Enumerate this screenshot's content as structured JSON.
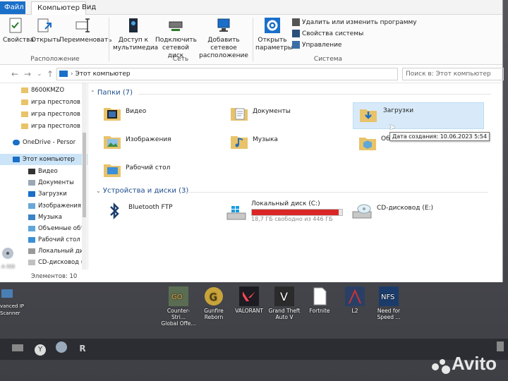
{
  "tabs": {
    "file": "Файл",
    "computer": "Компьютер",
    "view": "Вид"
  },
  "ribbon": {
    "properties": "Свойства",
    "open": "Открыть",
    "rename": "Переименовать",
    "location_group": "Расположение",
    "media_access_1": "Доступ к",
    "media_access_2": "мультимедиа",
    "map_drive_1": "Подключить",
    "map_drive_2": "сетевой диск",
    "add_location_1": "Добавить сетевое",
    "add_location_2": "расположение",
    "network_group": "Сеть",
    "open_settings_1": "Открыть",
    "open_settings_2": "параметры",
    "uninstall": "Удалить или изменить программу",
    "system_props": "Свойства системы",
    "manage": "Управление",
    "system_group": "Система"
  },
  "address": {
    "path": "Этот компьютер",
    "search_placeholder": "Поиск в: Этот компьютер"
  },
  "sidebar": {
    "items": [
      "8600KMZO",
      "игра престолов",
      "игра престолов",
      "игра престолов",
      "OneDrive - Persor",
      "Этот компьютер",
      "Видео",
      "Документы",
      "Загрузки",
      "Изображения",
      "Музыка",
      "Объемные объ",
      "Рабочий стол",
      "Локальный дис",
      "CD-дисковод (E"
    ]
  },
  "status": {
    "items_count": "Элементов: 10"
  },
  "folders_section": {
    "title": "Папки",
    "count": "(7)"
  },
  "folders": [
    "Видео",
    "Документы",
    "Загрузки",
    "Изображения",
    "Музыка",
    "Об",
    "Рабочий стол"
  ],
  "tooltip": "Дата создания: 10.06.2023 5:54",
  "drives_section": {
    "title": "Устройства и диски",
    "count": "(3)"
  },
  "drives": {
    "bluetooth": "Bluetooth FTP",
    "local_name": "Локальный диск (C:)",
    "local_free": "18,7 ГБ свободно из 446 ГБ",
    "local_used_fraction": 0.958,
    "cd": "CD-дисковод (E:)"
  },
  "desktop_icons": [
    {
      "label1": "Counter-Stri...",
      "label2": "Global Offe..."
    },
    {
      "label1": "Gunfire",
      "label2": "Reborn"
    },
    {
      "label1": "VALORANT",
      "label2": ""
    },
    {
      "label1": "Grand Theft",
      "label2": "Auto V"
    },
    {
      "label1": "Fortnite",
      "label2": ""
    },
    {
      "label1": "L2",
      "label2": ""
    },
    {
      "label1": "Need for",
      "label2": "Speed ..."
    }
  ],
  "left_desktop": {
    "iso": "A ISO",
    "scanner1": "vanced IP",
    "scanner2": "Scanner"
  },
  "watermark": "Avito",
  "colors": {
    "file_tab": "#1a6fc9",
    "disk_bar": "#da2626",
    "selection": "#cce4f7"
  }
}
